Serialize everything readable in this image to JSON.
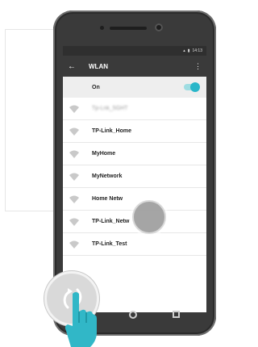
{
  "status_bar": {
    "time": "14:13"
  },
  "app_bar": {
    "title": "WLAN",
    "back_icon": "arrow-left-icon",
    "menu_icon": "more-vert-icon"
  },
  "toggle": {
    "label": "On",
    "state": "on",
    "accent": "#29b6c9"
  },
  "networks": [
    {
      "ssid": "Tp-Lnk_5GHT",
      "blurred": true
    },
    {
      "ssid": "TP-Link_Home",
      "blurred": false
    },
    {
      "ssid": "MyHome",
      "blurred": false
    },
    {
      "ssid": "MyNetwork",
      "blurred": false
    },
    {
      "ssid": "Home Netw",
      "blurred": false
    },
    {
      "ssid": "TP-Link_Netw",
      "blurred": false
    },
    {
      "ssid": "TP-Link_Test",
      "blurred": false
    }
  ],
  "colors": {
    "phone_body": "#3a3a3a",
    "app_bar": "#3a3a3a",
    "toggle_row": "#eeeeee"
  },
  "gesture": {
    "icon": "swipe-refresh-icon",
    "hand_icon": "pointing-hand-icon"
  }
}
